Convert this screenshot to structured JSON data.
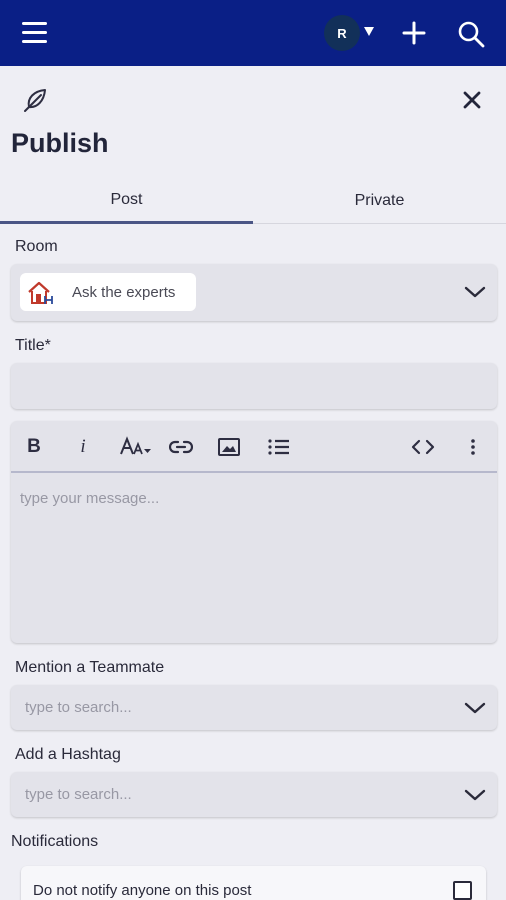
{
  "header": {
    "avatar_initial": "R",
    "icons": [
      "hamburger-menu-icon",
      "caret-down-icon",
      "plus-icon",
      "search-icon"
    ]
  },
  "panel": {
    "title": "Publish",
    "icons": [
      "feather-icon",
      "close-icon"
    ]
  },
  "tabs": [
    {
      "label": "Post",
      "active": true
    },
    {
      "label": "Private",
      "active": false
    }
  ],
  "room": {
    "label": "Room",
    "selected": "Ask the experts"
  },
  "title_field": {
    "label": "Title*",
    "value": ""
  },
  "editor": {
    "placeholder": "type your message...",
    "toolbar": [
      {
        "name": "bold-button",
        "glyph": "B"
      },
      {
        "name": "italic-button",
        "glyph": "i"
      },
      {
        "name": "font-size-button",
        "glyph": "AA"
      },
      {
        "name": "link-button",
        "glyph": "link-icon"
      },
      {
        "name": "image-button",
        "glyph": "image-icon"
      },
      {
        "name": "list-button",
        "glyph": "list-icon"
      },
      {
        "name": "code-button",
        "glyph": "code-icon"
      },
      {
        "name": "more-button",
        "glyph": "more-vertical-icon"
      }
    ]
  },
  "mention": {
    "label": "Mention a Teammate",
    "placeholder": "type to search..."
  },
  "hashtag": {
    "label": "Add a Hashtag",
    "placeholder": "type to search..."
  },
  "notifications": {
    "label": "Notifications",
    "option": "Do not notify anyone on this post",
    "checked": false
  },
  "colors": {
    "header_bg": "#0a1f86",
    "page_bg": "#eeeef4",
    "field_bg": "#e3e3ea",
    "active_tab_underline": "#4a5585"
  }
}
